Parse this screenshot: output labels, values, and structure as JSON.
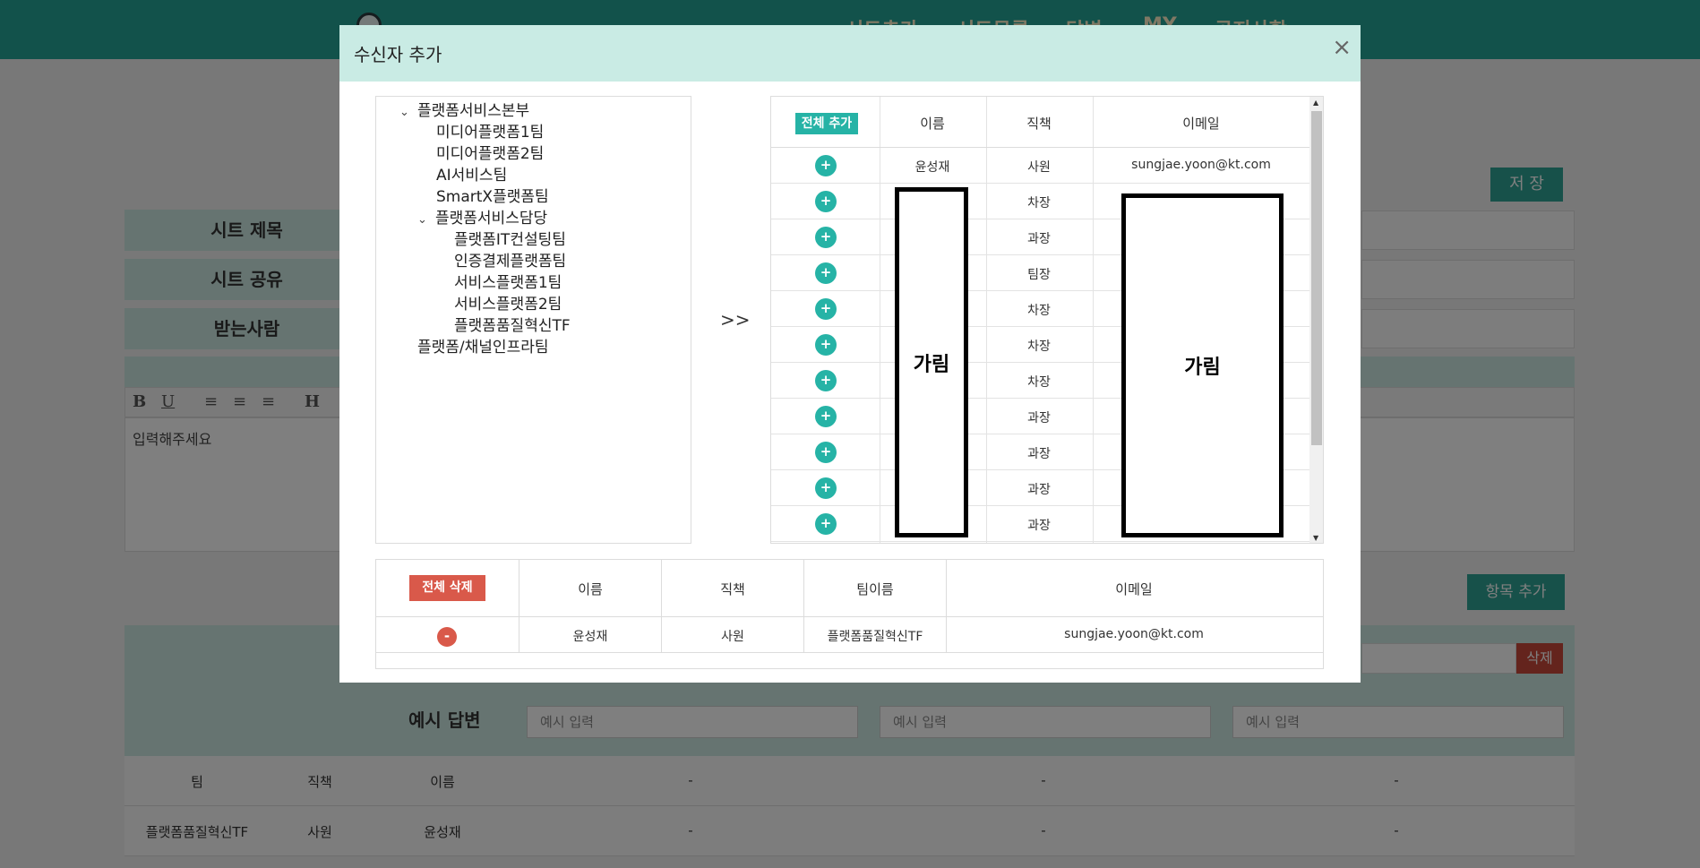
{
  "background": {
    "nav_items": [
      "시트추가",
      "시트목록",
      "답변",
      "MY",
      "공지사항"
    ],
    "save_label": "저 장",
    "form_labels": {
      "title": "시트 제목",
      "share": "시트 공유",
      "recipients": "받는사람"
    },
    "editor": {
      "toolbar": [
        "B",
        "U",
        "≡",
        "≡",
        "≡",
        "H"
      ],
      "placeholder": "입력해주세요"
    },
    "add_item_label": "항목 추가",
    "delete_label": "삭제",
    "example_answer_label": "예시 답변",
    "example_inputs": [
      "예시 입력",
      "예시 입력",
      "예시 입력"
    ],
    "result_table": {
      "headers": [
        "팀",
        "직책",
        "이름",
        "-",
        "-",
        "-"
      ],
      "row": [
        "플랫폼품질혁신TF",
        "사원",
        "윤성재",
        "-",
        "-",
        "-"
      ]
    }
  },
  "modal": {
    "title": "수신자 추가",
    "close_symbol": "×",
    "tree": [
      {
        "label": "플랫폼서비스본부",
        "expanded": true
      },
      {
        "label": "미디어플랫폼1팀"
      },
      {
        "label": "미디어플랫폼2팀"
      },
      {
        "label": "AI서비스팀"
      },
      {
        "label": "SmartX플랫폼팀"
      },
      {
        "label": "플랫폼서비스담당",
        "expanded": true
      },
      {
        "label": "플랫폼IT컨설팅팀"
      },
      {
        "label": "인증결제플랫폼팀"
      },
      {
        "label": "서비스플랫폼1팀"
      },
      {
        "label": "서비스플랫폼2팀"
      },
      {
        "label": "플랫폼품질혁신TF"
      },
      {
        "label": "플랫폼/채널인프라팀"
      }
    ],
    "move_label": ">>",
    "candidates": {
      "add_all_label": "전체 추가",
      "headers": {
        "name": "이름",
        "position": "직책",
        "email": "이메일"
      },
      "plus_symbol": "+",
      "rows": [
        {
          "name": "윤성재",
          "position": "사원",
          "email": "sungjae.yoon@kt.com"
        },
        {
          "name": "",
          "position": "차장",
          "email": ""
        },
        {
          "name": "",
          "position": "과장",
          "email": ""
        },
        {
          "name": "",
          "position": "팀장",
          "email": ""
        },
        {
          "name": "",
          "position": "차장",
          "email": ""
        },
        {
          "name": "",
          "position": "차장",
          "email": ""
        },
        {
          "name": "",
          "position": "차장",
          "email": ""
        },
        {
          "name": "",
          "position": "과장",
          "email": ""
        },
        {
          "name": "",
          "position": "과장",
          "email": ""
        },
        {
          "name": "",
          "position": "과장",
          "email": ""
        },
        {
          "name": "",
          "position": "과장",
          "email": ""
        }
      ],
      "redaction_label": "가림"
    },
    "selected": {
      "delete_all_label": "전체 삭제",
      "headers": {
        "name": "이름",
        "position": "직책",
        "team": "팀이름",
        "email": "이메일"
      },
      "minus_symbol": "-",
      "rows": [
        {
          "name": "윤성재",
          "position": "사원",
          "team": "플랫폼품질혁신TF",
          "email": "sungjae.yoon@kt.com"
        }
      ]
    }
  }
}
